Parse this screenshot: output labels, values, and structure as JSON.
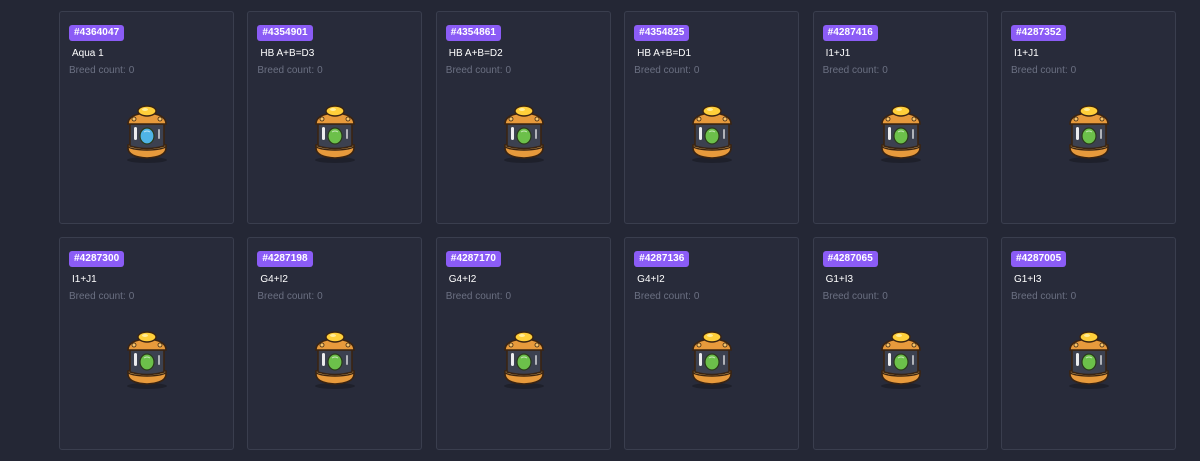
{
  "cards": [
    {
      "id": "#4364047",
      "name": "Aqua 1",
      "breed_label": "Breed count:",
      "breed_count": "0",
      "egg_type": "aqua-egg-icon",
      "core_color": "#4fb4e6"
    },
    {
      "id": "#4354901",
      "name": "HB A+B=D3",
      "breed_label": "Breed count:",
      "breed_count": "0",
      "egg_type": "plant-egg-icon",
      "core_color": "#6cc04a"
    },
    {
      "id": "#4354861",
      "name": "HB A+B=D2",
      "breed_label": "Breed count:",
      "breed_count": "0",
      "egg_type": "plant-egg-icon",
      "core_color": "#6cc04a"
    },
    {
      "id": "#4354825",
      "name": "HB A+B=D1",
      "breed_label": "Breed count:",
      "breed_count": "0",
      "egg_type": "plant-egg-icon",
      "core_color": "#6cc04a"
    },
    {
      "id": "#4287416",
      "name": "I1+J1",
      "breed_label": "Breed count:",
      "breed_count": "0",
      "egg_type": "plant-egg-icon",
      "core_color": "#6cc04a"
    },
    {
      "id": "#4287352",
      "name": "I1+J1",
      "breed_label": "Breed count:",
      "breed_count": "0",
      "egg_type": "plant-egg-icon",
      "core_color": "#6cc04a"
    },
    {
      "id": "#4287300",
      "name": "I1+J1",
      "breed_label": "Breed count:",
      "breed_count": "0",
      "egg_type": "plant-egg-icon",
      "core_color": "#6cc04a"
    },
    {
      "id": "#4287198",
      "name": "G4+I2",
      "breed_label": "Breed count:",
      "breed_count": "0",
      "egg_type": "plant-egg-icon",
      "core_color": "#6cc04a"
    },
    {
      "id": "#4287170",
      "name": "G4+I2",
      "breed_label": "Breed count:",
      "breed_count": "0",
      "egg_type": "plant-egg-icon",
      "core_color": "#6cc04a"
    },
    {
      "id": "#4287136",
      "name": "G4+I2",
      "breed_label": "Breed count:",
      "breed_count": "0",
      "egg_type": "plant-egg-icon",
      "core_color": "#6cc04a"
    },
    {
      "id": "#4287065",
      "name": "G1+I3",
      "breed_label": "Breed count:",
      "breed_count": "0",
      "egg_type": "plant-egg-icon",
      "core_color": "#6cc04a"
    },
    {
      "id": "#4287005",
      "name": "G1+I3",
      "breed_label": "Breed count:",
      "breed_count": "0",
      "egg_type": "plant-egg-icon",
      "core_color": "#6cc04a"
    }
  ],
  "colors": {
    "background": "#242735",
    "card": "#282b3a",
    "badge": "#8b5cf6",
    "muted_text": "#6b7082"
  }
}
